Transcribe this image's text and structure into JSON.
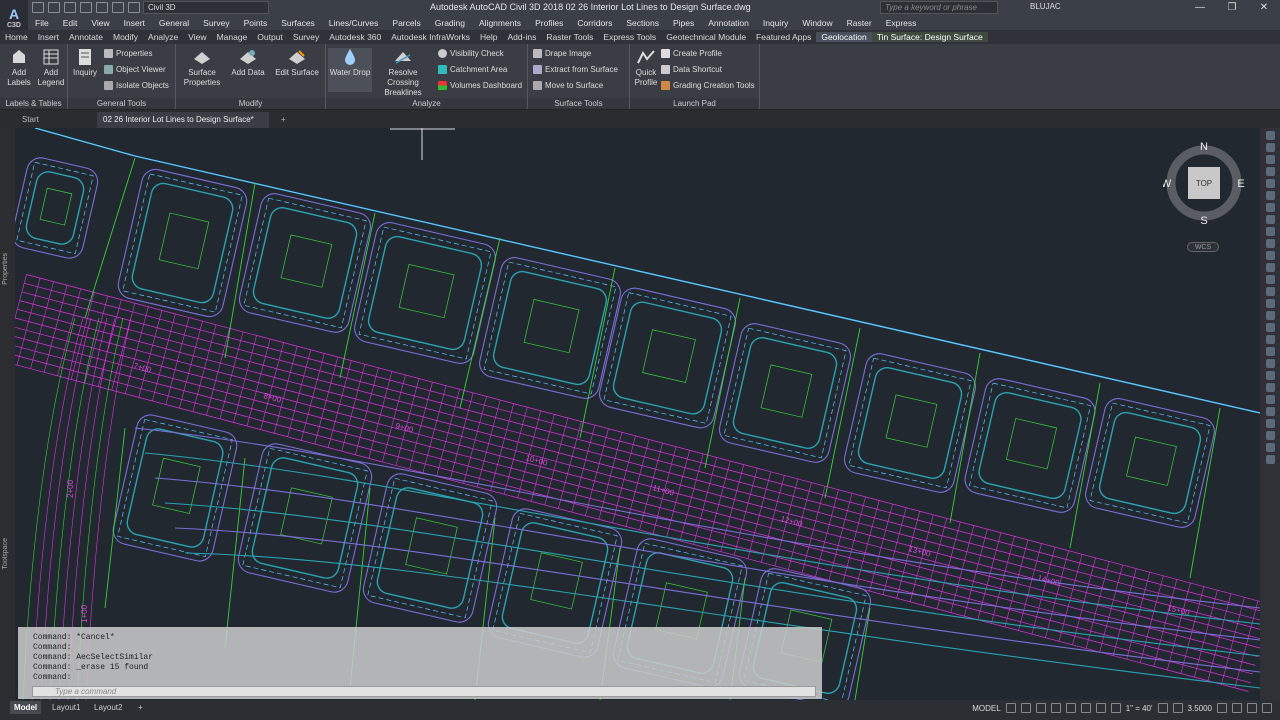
{
  "titlebar": {
    "app_abbrev": "A",
    "app_sub": "C3D",
    "workspace": "Civil 3D",
    "title": "Autodesk AutoCAD Civil 3D 2018    02 26 Interior Lot Lines to Design Surface.dwg",
    "search_placeholder": "Type a keyword or phrase",
    "user": "BLUJAC"
  },
  "menu": [
    "File",
    "Edit",
    "View",
    "Insert",
    "General",
    "Survey",
    "Points",
    "Surfaces",
    "Lines/Curves",
    "Parcels",
    "Grading",
    "Alignments",
    "Profiles",
    "Corridors",
    "Sections",
    "Pipes",
    "Annotation",
    "Inquiry",
    "Window",
    "Raster",
    "Express"
  ],
  "ribbon_tabs": [
    "Home",
    "Insert",
    "Annotate",
    "Modify",
    "Analyze",
    "View",
    "Manage",
    "Output",
    "Survey",
    "Autodesk 360",
    "Autodesk InfraWorks",
    "Help",
    "Add-ins",
    "Raster Tools",
    "Express Tools",
    "Geotechnical Module",
    "Featured Apps",
    "Geolocation",
    "Tin Surface: Design Surface"
  ],
  "ribbon": {
    "labels_tables": {
      "title": "Labels & Tables",
      "add_labels": "Add Labels",
      "add_legend": "Add Legend"
    },
    "general_tools": {
      "title": "General Tools",
      "inquiry": "Inquiry",
      "properties": "Properties",
      "object_viewer": "Object Viewer",
      "isolate_objects": "Isolate Objects"
    },
    "modify": {
      "title": "Modify",
      "surface_properties": "Surface Properties",
      "add_data": "Add Data",
      "edit_surface": "Edit Surface"
    },
    "analyze": {
      "title": "Analyze",
      "water_drop": "Water Drop",
      "resolve_crossing": "Resolve Crossing Breaklines",
      "visibility_check": "Visibility Check",
      "catchment_area": "Catchment Area",
      "volumes_dashboard": "Volumes Dashboard"
    },
    "surface_tools": {
      "title": "Surface Tools",
      "drape_image": "Drape Image",
      "extract_from_surface": "Extract from Surface",
      "move_to_surface": "Move to Surface"
    },
    "launch_pad": {
      "title": "Launch Pad",
      "quick_profile": "Quick Profile",
      "create_profile": "Create Profile",
      "data_shortcut": "Data Shortcut",
      "grading_creation_tools": "Grading Creation Tools"
    }
  },
  "doc_tabs": {
    "start": "Start",
    "active": "02 26 Interior Lot Lines to Design Surface*"
  },
  "side_labels": {
    "left_top": "Properties",
    "left_bottom": "Toolspace"
  },
  "viewcube": {
    "n": "N",
    "s": "S",
    "e": "E",
    "w": "W",
    "top": "TOP",
    "wcs": "WCS"
  },
  "stations": [
    "7+00",
    "8+00",
    "9+00",
    "10+00",
    "11+00",
    "12+00",
    "13+00",
    "14+00",
    "15+00",
    "2+00",
    "1+00"
  ],
  "command": {
    "history": "Command: *Cancel*\nCommand:\nCommand: AecSelectSimilar\nCommand: _erase 15 found\nCommand:",
    "placeholder": "Type a command"
  },
  "status": {
    "layouts": [
      "Model",
      "Layout1",
      "Layout2"
    ],
    "model": "MODEL",
    "scale": "1\" = 40'",
    "value": "3.5000"
  },
  "colors": {
    "contour_major": "#7b6fd6",
    "contour_minor": "#2aa3b0",
    "corridor": "#e033e0",
    "lot_lines": "#39d139",
    "row": "#58c8ff"
  }
}
